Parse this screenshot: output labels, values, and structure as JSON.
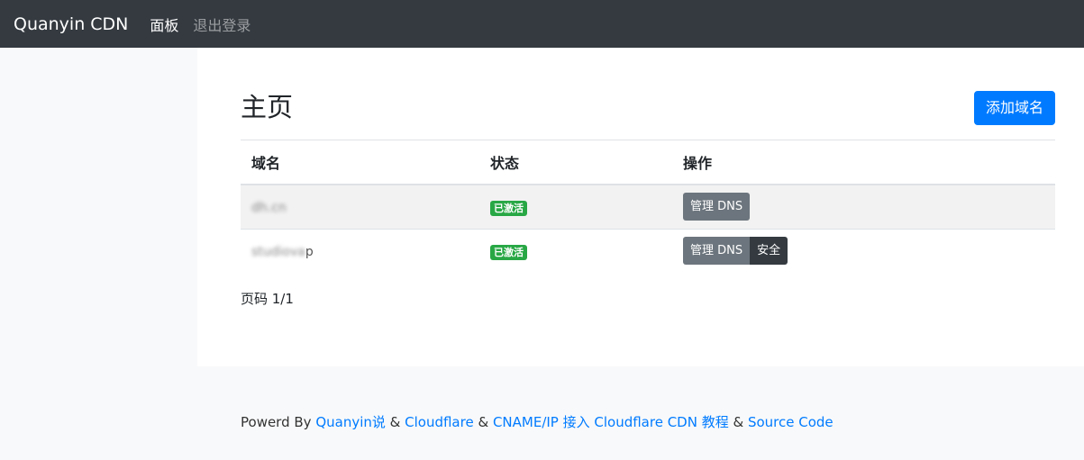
{
  "navbar": {
    "brand": "Quanyin CDN",
    "links": [
      {
        "label": "面板",
        "active": true
      },
      {
        "label": "退出登录",
        "active": false
      }
    ]
  },
  "main": {
    "title": "主页",
    "add_button": "添加域名",
    "table": {
      "headers": [
        "域名",
        "状态",
        "操作"
      ],
      "rows": [
        {
          "domain": "dh.cn",
          "domain_tail": "",
          "status": "已激活",
          "actions": [
            "管理 DNS"
          ]
        },
        {
          "domain": "studiova",
          "domain_tail": "p",
          "status": "已激活",
          "actions": [
            "管理 DNS",
            "安全"
          ]
        }
      ]
    },
    "pager": "页码 1/1"
  },
  "footer": {
    "prefix": "Powerd By ",
    "link1": "Quanyin说",
    "sep1": " & ",
    "link2": "Cloudflare",
    "sep2": " & ",
    "link3": "CNAME/IP 接入 Cloudflare CDN 教程",
    "sep3": " & ",
    "link4": "Source Code"
  },
  "colors": {
    "navbar": "#343a40",
    "primary": "#007bff",
    "success": "#28a745",
    "secondary": "#6c757d",
    "dark": "#343a40"
  }
}
